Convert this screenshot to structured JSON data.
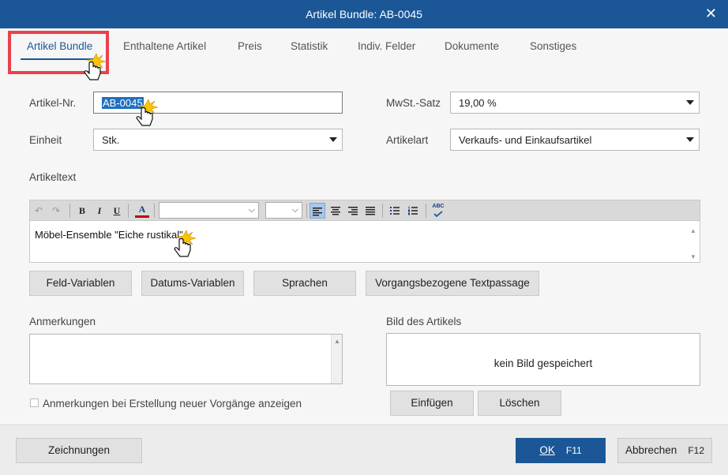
{
  "window": {
    "title": "Artikel Bundle: AB-0045",
    "close_glyph": "✕"
  },
  "tabs": [
    {
      "label": "Artikel Bundle"
    },
    {
      "label": "Enthaltene Artikel"
    },
    {
      "label": "Preis"
    },
    {
      "label": "Statistik"
    },
    {
      "label": "Indiv. Felder"
    },
    {
      "label": "Dokumente"
    },
    {
      "label": "Sonstiges"
    }
  ],
  "form": {
    "artikel_nr_label": "Artikel-Nr.",
    "artikel_nr_value": "AB-0045",
    "einheit_label": "Einheit",
    "einheit_value": "Stk.",
    "mwst_label": "MwSt.-Satz",
    "mwst_value": "19,00 %",
    "artikelart_label": "Artikelart",
    "artikelart_value": "Verkaufs- und Einkaufsartikel",
    "artikeltext_label": "Artikeltext",
    "artikeltext_value": "Möbel-Ensemble \"Eiche rustikal\"",
    "anmerkungen_label": "Anmerkungen",
    "anmerkungen_value": "",
    "checkbox_label": "Anmerkungen bei Erstellung neuer Vorgänge anzeigen",
    "bild_label": "Bild des Artikels",
    "bild_empty_text": "kein Bild gespeichert"
  },
  "toolbar": {
    "bold": "B",
    "italic": "I",
    "underline": "U",
    "font_color": "A",
    "font_color_hex": "#c00000",
    "undo_icon": "↶",
    "redo_icon": "↷",
    "spell_icon": "ABC",
    "dropdown_caret": "⌵"
  },
  "editor_buttons": [
    {
      "label": "Feld-Variablen"
    },
    {
      "label": "Datums-Variablen"
    },
    {
      "label": "Sprachen"
    },
    {
      "label": "Vorgangsbezogene Textpassage"
    }
  ],
  "image_buttons": {
    "insert": "Einfügen",
    "delete": "Löschen"
  },
  "footer": {
    "drawings": "Zeichnungen",
    "ok": "OK",
    "ok_key": "F11",
    "cancel": "Abbrechen",
    "cancel_key": "F12"
  },
  "colors": {
    "brand_blue": "#1b5797",
    "highlight_red": "#e8424c",
    "selection_blue": "#1f6fbf"
  }
}
